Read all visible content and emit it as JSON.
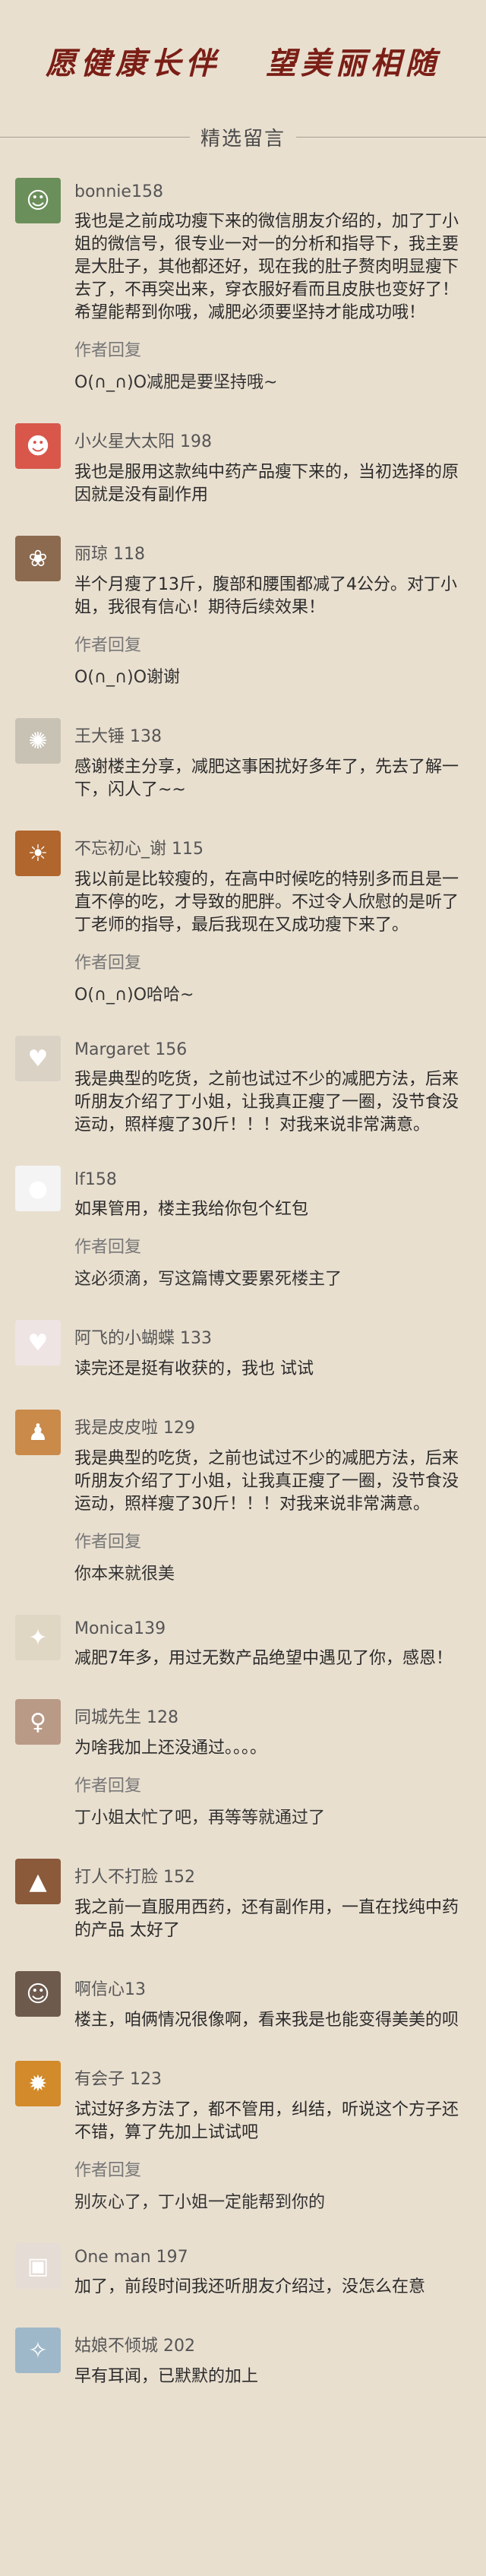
{
  "header": {
    "slogan": "愿健康长伴   望美丽相随"
  },
  "section": {
    "title": "精选留言"
  },
  "reply_label": "作者回复",
  "comments": [
    {
      "name": "bonnie158",
      "avatar_icon": "person-icon",
      "avatar_color": "#6b8f5a",
      "text": "我也是之前成功瘦下来的微信朋友介绍的，加了丁小姐的微信号，很专业一对一的分析和指导下，我主要是大肚子，其他都还好，现在我的肚子赘肉明显瘦下去了，不再突出来，穿衣服好看而且皮肤也变好了！希望能帮到你哦，减肥必须要坚持才能成功哦！",
      "reply": "O(∩_∩)O减肥是要坚持哦~"
    },
    {
      "name": "小火星大太阳 198",
      "avatar_icon": "cartoon-face-icon",
      "avatar_color": "#d8574a",
      "text": "我也是服用这款纯中药产品瘦下来的，当初选择的原因就是没有副作用"
    },
    {
      "name": "丽琼 118",
      "avatar_icon": "flower-icon",
      "avatar_color": "#8b6a4f",
      "text": "半个月瘦了13斤，腹部和腰围都减了4公分。对丁小姐，我很有信心！期待后续效果！",
      "reply": "O(∩_∩)O谢谢"
    },
    {
      "name": "王大锤 138",
      "avatar_icon": "dandelion-icon",
      "avatar_color": "#c8c2b4",
      "text": "感谢楼主分享，减肥这事困扰好多年了，先去了解一下，闪人了~~"
    },
    {
      "name": "不忘初心_谢 115",
      "avatar_icon": "sunset-icon",
      "avatar_color": "#b0662c",
      "text": "我以前是比较瘦的，在高中时候吃的特别多而且是一直不停的吃，才导致的肥胖。不过令人欣慰的是听了丁老师的指导，最后我现在又成功瘦下来了。",
      "reply": "O(∩_∩)O哈哈~"
    },
    {
      "name": "Margaret 156",
      "avatar_icon": "cat-icon",
      "avatar_color": "#d9d2c5",
      "text": "我是典型的吃货，之前也试过不少的减肥方法，后来听朋友介绍了丁小姐，让我真正瘦了一圈，没节食没运动，照样瘦了30斤！！！对我来说非常满意。"
    },
    {
      "name": "lf158",
      "avatar_icon": "panda-icon",
      "avatar_color": "#f4f4f4",
      "text": "如果管用，楼主我给你包个红包",
      "reply": "这必须滴，写这篇博文要累死楼主了"
    },
    {
      "name": "阿飞的小蝴蝶 133",
      "avatar_icon": "heart-icon",
      "avatar_color": "#efe4e4",
      "text": "读完还是挺有收获的，我也 试试"
    },
    {
      "name": "我是皮皮啦 129",
      "avatar_icon": "silhouette-icon",
      "avatar_color": "#c98a4a",
      "text": "我是典型的吃货，之前也试过不少的减肥方法，后来听朋友介绍了丁小姐，让我真正瘦了一圈，没节食没运动，照样瘦了30斤！！！对我来说非常满意。",
      "reply": "你本来就很美"
    },
    {
      "name": "Monica139",
      "avatar_icon": "bird-icon",
      "avatar_color": "#e0d6c4",
      "text": "减肥7年多，用过无数产品绝望中遇见了你，感恩！"
    },
    {
      "name": "同城先生 128",
      "avatar_icon": "girl-icon",
      "avatar_color": "#b99a86",
      "text": "为啥我加上还没通过。。。。",
      "reply": "丁小姐太忙了吧，再等等就通过了"
    },
    {
      "name": "打人不打脸 152",
      "avatar_icon": "landscape-icon",
      "avatar_color": "#8a5a3a",
      "text": "我之前一直服用西药，还有副作用，一直在找纯中药的产品 太好了"
    },
    {
      "name": "啊信心13",
      "avatar_icon": "portrait-icon",
      "avatar_color": "#6d5a4d",
      "text": "楼主，咱俩情况很像啊，看来我是也能变得美美的呗"
    },
    {
      "name": "有会子 123",
      "avatar_icon": "lion-icon",
      "avatar_color": "#d28a2a",
      "text": "试过好多方法了，都不管用，纠结，听说这个方子还不错，算了先加上试试吧",
      "reply": "别灰心了，丁小姐一定能帮到你的"
    },
    {
      "name": "One man 197",
      "avatar_icon": "photo-icon",
      "avatar_color": "#e5dcd6",
      "text": "加了，前段时间我还听朋友介绍过，没怎么在意"
    },
    {
      "name": "姑娘不倾城 202",
      "avatar_icon": "dancer-icon",
      "avatar_color": "#9fb8c9",
      "text": "早有耳闻，已默默的加上"
    }
  ]
}
